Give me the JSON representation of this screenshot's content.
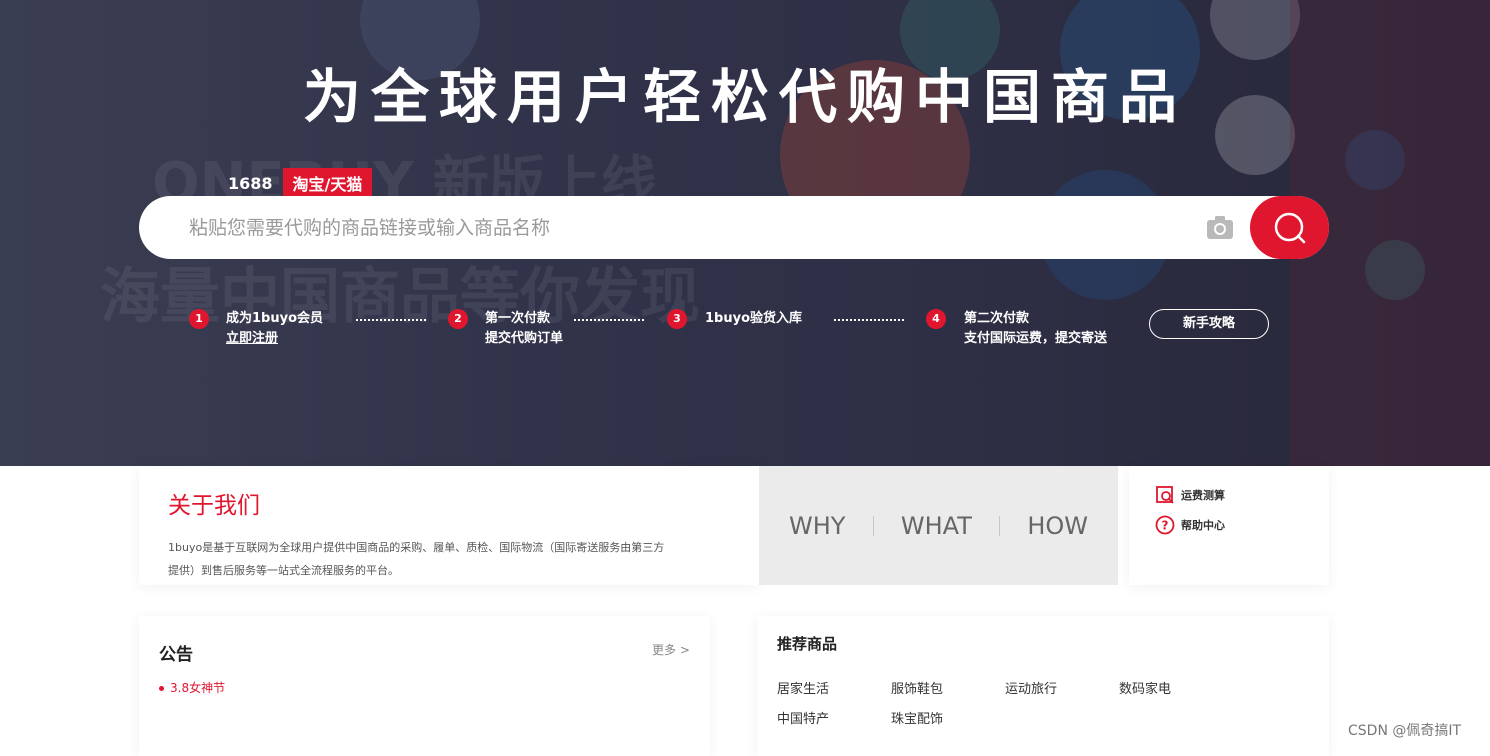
{
  "hero": {
    "title": "为全球用户轻松代购中国商品",
    "bg_ghost_line1": "ONEBUY 新版上线",
    "bg_ghost_line2": "海量中国商品等你发现",
    "tabs": [
      {
        "label": "1688",
        "active": false
      },
      {
        "label": "淘宝/天猫",
        "active": true
      }
    ]
  },
  "search": {
    "placeholder": "粘贴您需要代购的商品链接或输入商品名称",
    "value": "",
    "camera_icon": "camera-icon",
    "search_icon": "search-icon"
  },
  "steps": [
    {
      "num": "1",
      "line1": "成为1buyo会员",
      "line2": "立即注册"
    },
    {
      "num": "2",
      "line1": "第一次付款",
      "line2": "提交代购订单"
    },
    {
      "num": "3",
      "line1": "1buyo验货入库",
      "line2": ""
    },
    {
      "num": "4",
      "line1": "第二次付款",
      "line2": "支付国际运费，提交寄送"
    }
  ],
  "guide_button": "新手攻略",
  "about": {
    "title": "关于我们",
    "desc": "1buyo是基于互联网为全球用户提供中国商品的采购、履单、质检、国际物流（国际寄送服务由第三方提供）到售后服务等一站式全流程服务的平台。"
  },
  "wwh": [
    "WHY",
    "WHAT",
    "HOW"
  ],
  "tools": [
    {
      "label": "运费测算",
      "icon": "shipping-calc-icon"
    },
    {
      "label": "帮助中心",
      "icon": "help-icon"
    }
  ],
  "notice": {
    "title": "公告",
    "more": "更多 >",
    "items": [
      "3.8女神节"
    ]
  },
  "recommend": {
    "title": "推荐商品",
    "categories": [
      "居家生活",
      "服饰鞋包",
      "运动旅行",
      "数码家电",
      "中国特产",
      "珠宝配饰"
    ]
  },
  "watermark": "CSDN @佩奇搞IT",
  "colors": {
    "accent": "#e0162f",
    "hero_bg": "#3d4058",
    "panel_grey": "#ebebeb"
  }
}
